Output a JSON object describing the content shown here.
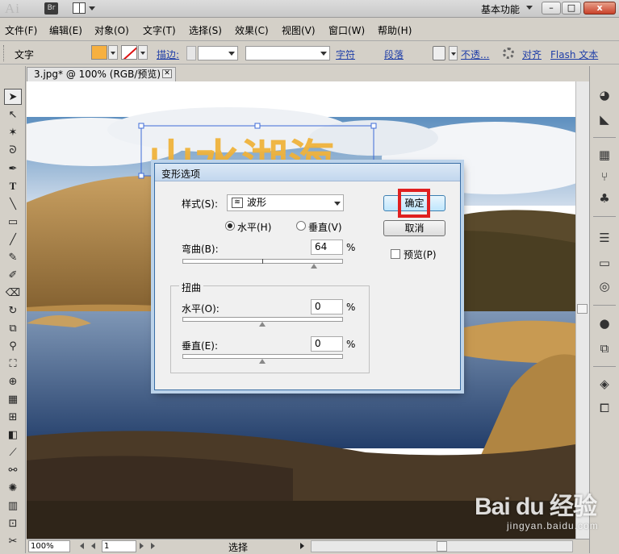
{
  "titlebar": {
    "app_logo": "Ai",
    "bridge_button": "Br",
    "workspace": "基本功能",
    "window_buttons": {
      "minimize": "–",
      "maximize": "□",
      "close": "x"
    }
  },
  "menu": [
    "文件(F)",
    "编辑(E)",
    "对象(O)",
    "文字(T)",
    "选择(S)",
    "效果(C)",
    "视图(V)",
    "窗口(W)",
    "帮助(H)"
  ],
  "control_bar": {
    "mode_label": "文字",
    "fill_color": "#f6b040",
    "stroke_label": "描边:",
    "character_link": "字符",
    "paragraph_link": "段落",
    "opacity_link": "不透...",
    "align_link": "对齐",
    "flash_text_link": "Flash 文本"
  },
  "document": {
    "tab_title": "3.jpg* @ 100% (RGB/预览)",
    "artwork_text": "山水湖海"
  },
  "status_bar": {
    "zoom": "100%",
    "page": "1",
    "status": "选择"
  },
  "dialog": {
    "title": "变形选项",
    "style_label": "样式(S):",
    "style_value": "波形",
    "orientation": {
      "horizontal_label": "水平(H)",
      "vertical_label": "垂直(V)",
      "selected": "horizontal"
    },
    "bend_label": "弯曲(B):",
    "bend_value": "64",
    "percent": "%",
    "distortion_group": "扭曲",
    "distort_horizontal_label": "水平(O):",
    "distort_horizontal_value": "0",
    "distort_vertical_label": "垂直(E):",
    "distort_vertical_value": "0",
    "ok_label": "确定",
    "cancel_label": "取消",
    "preview_label": "预览(P)",
    "preview_checked": false
  },
  "watermark": {
    "logo": "Bai du 经验",
    "url": "jingyan.baidu.com"
  }
}
